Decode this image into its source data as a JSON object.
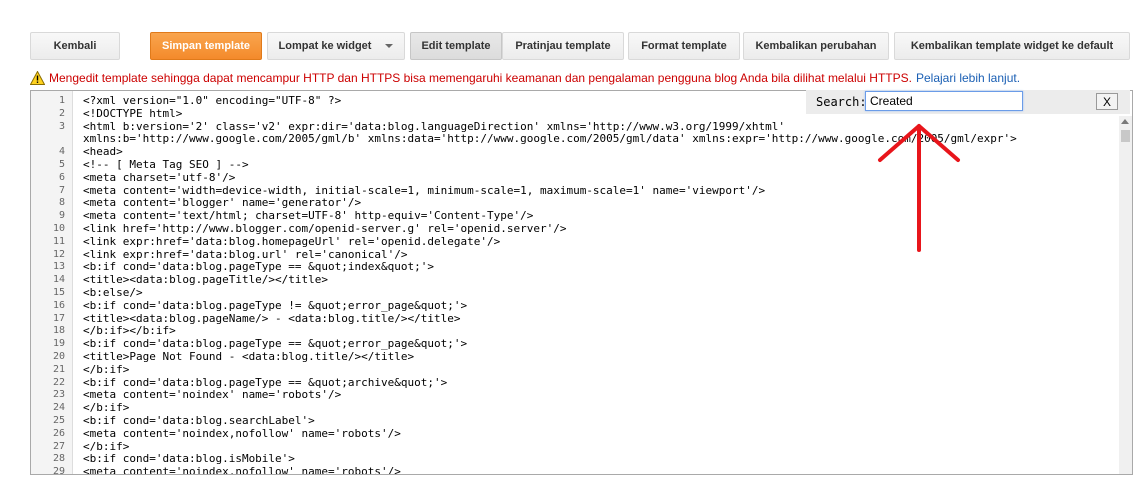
{
  "toolbar": {
    "back": "Kembali",
    "save": "Simpan template",
    "jump_widget": "Lompat ke widget",
    "edit": "Edit template",
    "preview": "Pratinjau template",
    "format": "Format template",
    "revert": "Kembalikan perubahan",
    "revert_default": "Kembalikan template widget ke default"
  },
  "warning": {
    "text": "Mengedit template sehingga dapat mencampur HTTP dan HTTPS bisa memengaruhi keamanan dan pengalaman pengguna blog Anda bila dilihat melalui HTTPS.",
    "link": "Pelajari lebih lanjut."
  },
  "search": {
    "label": "Search:",
    "value": "Created",
    "close": "X"
  },
  "colors": {
    "primary": "#f48a2b",
    "warning": "#cc0000",
    "link": "#1a5fb4",
    "annotation": "#e8151b"
  },
  "editor": {
    "lines": [
      {
        "n": "1",
        "code": "<?xml version=\"1.0\" encoding=\"UTF-8\" ?>"
      },
      {
        "n": "2",
        "code": "<!DOCTYPE html>"
      },
      {
        "n": "3",
        "code": "<html b:version='2' class='v2' expr:dir='data:blog.languageDirection' xmlns='http://www.w3.org/1999/xhtml'"
      },
      {
        "n": "",
        "code": "xmlns:b='http://www.google.com/2005/gml/b' xmlns:data='http://www.google.com/2005/gml/data' xmlns:expr='http://www.google.com/2005/gml/expr'>"
      },
      {
        "n": "4",
        "code": "<head>"
      },
      {
        "n": "5",
        "code": "<!-- [ Meta Tag SEO ] -->"
      },
      {
        "n": "6",
        "code": "<meta charset='utf-8'/>"
      },
      {
        "n": "7",
        "code": "<meta content='width=device-width, initial-scale=1, minimum-scale=1, maximum-scale=1' name='viewport'/>"
      },
      {
        "n": "8",
        "code": "<meta content='blogger' name='generator'/>"
      },
      {
        "n": "9",
        "code": "<meta content='text/html; charset=UTF-8' http-equiv='Content-Type'/>"
      },
      {
        "n": "10",
        "code": "<link href='http://www.blogger.com/openid-server.g' rel='openid.server'/>"
      },
      {
        "n": "11",
        "code": "<link expr:href='data:blog.homepageUrl' rel='openid.delegate'/>"
      },
      {
        "n": "12",
        "code": "<link expr:href='data:blog.url' rel='canonical'/>"
      },
      {
        "n": "13",
        "code": "<b:if cond='data:blog.pageType == &quot;index&quot;'>"
      },
      {
        "n": "14",
        "code": "<title><data:blog.pageTitle/></title>"
      },
      {
        "n": "15",
        "code": "<b:else/>"
      },
      {
        "n": "16",
        "code": "<b:if cond='data:blog.pageType != &quot;error_page&quot;'>"
      },
      {
        "n": "17",
        "code": "<title><data:blog.pageName/> - <data:blog.title/></title>"
      },
      {
        "n": "18",
        "code": "</b:if></b:if>"
      },
      {
        "n": "19",
        "code": "<b:if cond='data:blog.pageType == &quot;error_page&quot;'>"
      },
      {
        "n": "20",
        "code": "<title>Page Not Found - <data:blog.title/></title>"
      },
      {
        "n": "21",
        "code": "</b:if>"
      },
      {
        "n": "22",
        "code": "<b:if cond='data:blog.pageType == &quot;archive&quot;'>"
      },
      {
        "n": "23",
        "code": "<meta content='noindex' name='robots'/>"
      },
      {
        "n": "24",
        "code": "</b:if>"
      },
      {
        "n": "25",
        "code": "<b:if cond='data:blog.searchLabel'>"
      },
      {
        "n": "26",
        "code": "<meta content='noindex,nofollow' name='robots'/>"
      },
      {
        "n": "27",
        "code": "</b:if>"
      },
      {
        "n": "28",
        "code": "<b:if cond='data:blog.isMobile'>"
      },
      {
        "n": "29",
        "code": "<meta content='noindex,nofollow' name='robots'/>"
      }
    ]
  }
}
